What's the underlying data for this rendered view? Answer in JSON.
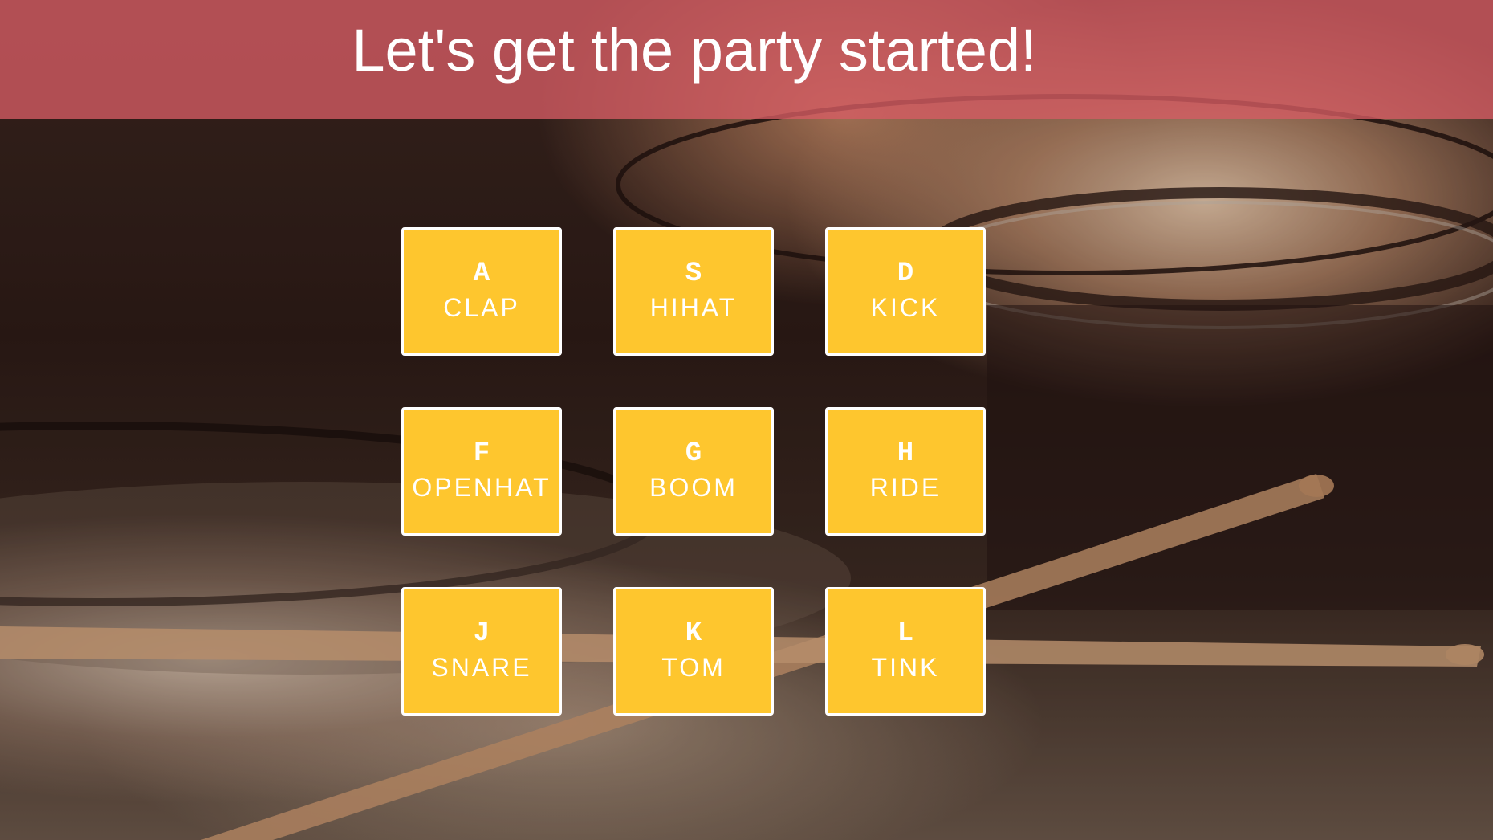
{
  "header": {
    "title": "Let's get the party started!"
  },
  "pads": [
    {
      "key": "A",
      "sound": "CLAP"
    },
    {
      "key": "S",
      "sound": "HIHAT"
    },
    {
      "key": "D",
      "sound": "KICK"
    },
    {
      "key": "F",
      "sound": "OPENHAT"
    },
    {
      "key": "G",
      "sound": "BOOM"
    },
    {
      "key": "H",
      "sound": "RIDE"
    },
    {
      "key": "J",
      "sound": "SNARE"
    },
    {
      "key": "K",
      "sound": "TOM"
    },
    {
      "key": "L",
      "sound": "TINK"
    }
  ],
  "colors": {
    "header_bg": "#d65c64",
    "pad_bg": "#fec62e",
    "pad_border": "#ffffff",
    "text": "#ffffff"
  }
}
